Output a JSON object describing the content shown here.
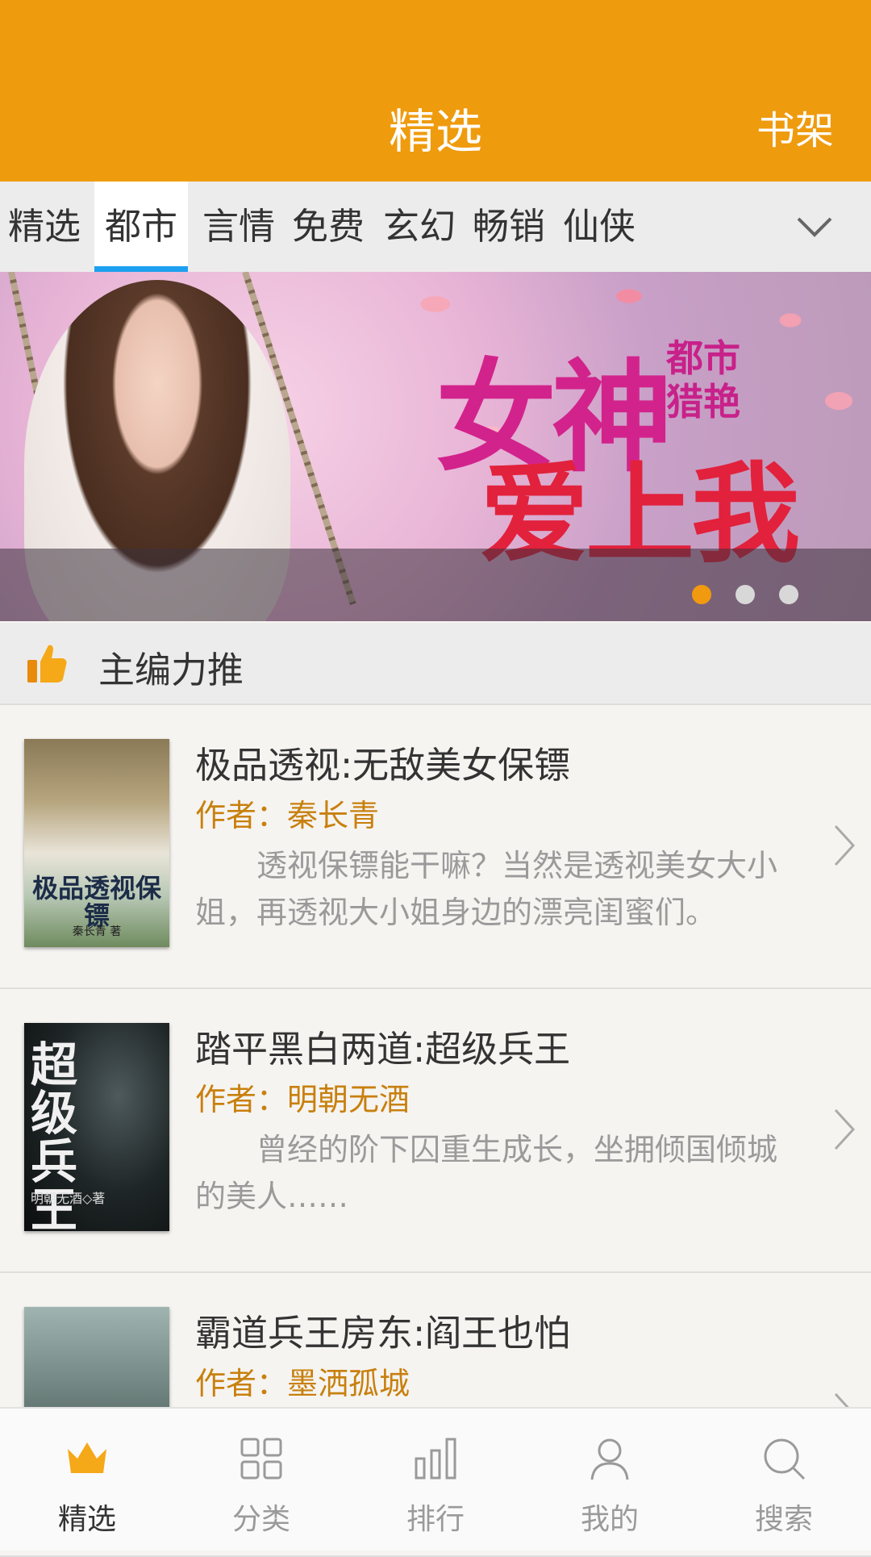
{
  "header": {
    "title": "精选",
    "shelf": "书架"
  },
  "tabs": [
    "精选",
    "都市",
    "言情",
    "免费",
    "玄幻",
    "畅销",
    "仙侠"
  ],
  "active_tab": "都市",
  "banner": {
    "line1": "女神",
    "line2": "爱上我",
    "tag1": "都市",
    "tag2": "猎艳",
    "slide_count": 3,
    "active_slide": 1
  },
  "section": {
    "title": "主编力推"
  },
  "books": [
    {
      "title": "极品透视:无敌美女保镖",
      "author_label": "作者：",
      "author": "秦长青",
      "desc": "透视保镖能干嘛？当然是透视美女大小姐，再透视大小姐身边的漂亮闺蜜们。",
      "cover_title": "极品透视保镖",
      "cover_author": "秦长青 著"
    },
    {
      "title": "踏平黑白两道:超级兵王",
      "author_label": "作者：",
      "author": "明朝无酒",
      "desc": "曾经的阶下囚重生成长，坐拥倾国倾城的美人……",
      "cover_title": "超级兵王",
      "cover_author": "明朝无酒◇著"
    },
    {
      "title": "霸道兵王房东:阎王也怕",
      "author_label": "作者：",
      "author": "墨洒孤城",
      "desc": "",
      "cover_title": "",
      "cover_author": ""
    }
  ],
  "nav": [
    {
      "label": "精选",
      "icon": "crown-icon",
      "active": true
    },
    {
      "label": "分类",
      "icon": "grid-icon",
      "active": false
    },
    {
      "label": "排行",
      "icon": "bar-chart-icon",
      "active": false
    },
    {
      "label": "我的",
      "icon": "person-icon",
      "active": false
    },
    {
      "label": "搜索",
      "icon": "search-icon",
      "active": false
    }
  ],
  "colors": {
    "accent": "#ef9b0e",
    "tab_underline": "#1ea0f0",
    "author": "#c8800e"
  }
}
